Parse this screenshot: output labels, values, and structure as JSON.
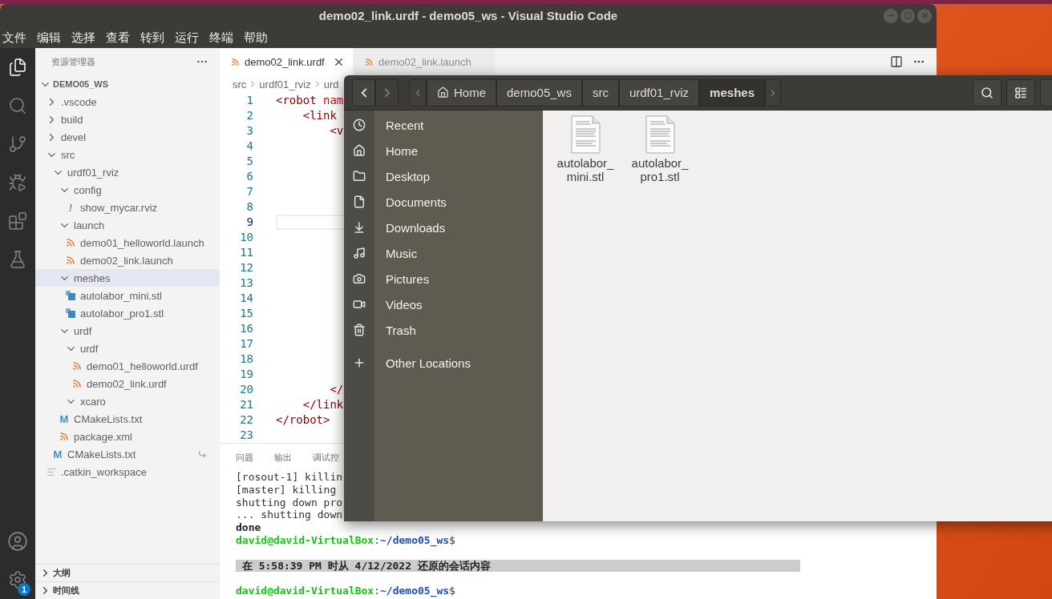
{
  "vscode": {
    "title": "demo02_link.urdf - demo05_ws - Visual Studio Code",
    "menu": [
      "文件",
      "编辑",
      "选择",
      "查看",
      "转到",
      "运行",
      "终端",
      "帮助"
    ],
    "activity_bar": {
      "top": [
        {
          "selected": true
        },
        {
          "selected": false
        },
        {
          "selected": false
        },
        {
          "selected": false
        },
        {
          "selected": false
        },
        {
          "selected": false
        }
      ],
      "bottom": [
        {
          "selected": false
        },
        {
          "selected": false
        }
      ],
      "badge": "1"
    },
    "explorer": {
      "title": "资源管理器",
      "root": {
        "label": "DEMO05_WS",
        "expanded": true
      },
      "tree": [
        {
          "label": ".vscode",
          "kind": "folder",
          "expanded": false,
          "selected": false
        },
        {
          "label": "build",
          "kind": "folder",
          "expanded": false,
          "selected": false
        },
        {
          "label": "devel",
          "kind": "folder",
          "expanded": false,
          "selected": false
        },
        {
          "label": "src",
          "kind": "folder",
          "expanded": true,
          "selected": false,
          "children": [
            {
              "label": "urdf01_rviz",
              "kind": "folder",
              "expanded": true,
              "selected": false,
              "children": [
                {
                  "label": "config",
                  "kind": "folder",
                  "expanded": true,
                  "selected": false,
                  "children": [
                    {
                      "label": "show_mycar.rviz",
                      "kind": "rviz",
                      "glyph": "!",
                      "selected": false
                    }
                  ]
                },
                {
                  "label": "launch",
                  "kind": "folder",
                  "expanded": true,
                  "selected": false,
                  "children": [
                    {
                      "label": "demo01_helloworld.launch",
                      "kind": "rss",
                      "selected": false
                    },
                    {
                      "label": "demo02_link.launch",
                      "kind": "rss",
                      "selected": false
                    }
                  ]
                },
                {
                  "label": "meshes",
                  "kind": "folder",
                  "expanded": true,
                  "selected": true,
                  "children": [
                    {
                      "label": "autolabor_mini.stl",
                      "kind": "stl",
                      "selected": false
                    },
                    {
                      "label": "autolabor_pro1.stl",
                      "kind": "stl",
                      "selected": false
                    }
                  ]
                },
                {
                  "label": "urdf",
                  "kind": "folder",
                  "expanded": true,
                  "selected": false,
                  "children": [
                    {
                      "label": "urdf",
                      "kind": "folder",
                      "expanded": true,
                      "selected": false,
                      "children": [
                        {
                          "label": "demo01_helloworld.urdf",
                          "kind": "rss",
                          "selected": false
                        },
                        {
                          "label": "demo02_link.urdf",
                          "kind": "rss",
                          "selected": false
                        }
                      ]
                    },
                    {
                      "label": "xcaro",
                      "kind": "folder",
                      "expanded": true,
                      "selected": false
                    }
                  ]
                },
                {
                  "label": "CMakeLists.txt",
                  "kind": "cmake",
                  "glyph": "M",
                  "selected": false
                },
                {
                  "label": "package.xml",
                  "kind": "rss",
                  "selected": false
                }
              ]
            },
            {
              "label": "CMakeLists.txt",
              "kind": "cmake",
              "glyph": "M",
              "selected": false,
              "symlink": true
            }
          ]
        },
        {
          "label": ".catkin_workspace",
          "kind": "text",
          "selected": false
        }
      ],
      "sections": [
        {
          "label": "大纲",
          "expanded": false
        },
        {
          "label": "时间线",
          "expanded": false
        }
      ]
    },
    "tabs": [
      {
        "label": "demo02_link.urdf",
        "selected": true
      },
      {
        "label": "demo02_link.launch",
        "selected": false
      }
    ],
    "breadcrumbs": [
      "src",
      "urdf01_rviz",
      "urd"
    ],
    "code_lines": [
      {
        "number": "1",
        "current": false,
        "tokens": [
          {
            "kind": "tag",
            "text": "<robot"
          },
          {
            "kind": "attr",
            "text": " nam"
          }
        ]
      },
      {
        "number": "2",
        "current": false,
        "tokens": [
          {
            "kind": "tag",
            "text": "    <link"
          }
        ]
      },
      {
        "number": "3",
        "current": false,
        "tokens": [
          {
            "kind": "tag",
            "text": "        <v"
          }
        ]
      },
      {
        "number": "4",
        "current": false
      },
      {
        "number": "5",
        "current": false
      },
      {
        "number": "6",
        "current": false
      },
      {
        "number": "7",
        "current": false
      },
      {
        "number": "8",
        "current": false
      },
      {
        "number": "9",
        "current": true
      },
      {
        "number": "10",
        "current": false
      },
      {
        "number": "11",
        "current": false
      },
      {
        "number": "12",
        "current": false
      },
      {
        "number": "13",
        "current": false
      },
      {
        "number": "14",
        "current": false
      },
      {
        "number": "15",
        "current": false
      },
      {
        "number": "16",
        "current": false
      },
      {
        "number": "17",
        "current": false
      },
      {
        "number": "18",
        "current": false
      },
      {
        "number": "19",
        "current": false
      },
      {
        "number": "20",
        "current": false,
        "tokens": [
          {
            "kind": "tag",
            "text": "        </"
          }
        ]
      },
      {
        "number": "21",
        "current": false,
        "tokens": [
          {
            "kind": "tag",
            "text": "    </link"
          }
        ]
      },
      {
        "number": "22",
        "current": false,
        "tokens": [
          {
            "kind": "tag",
            "text": "</robot>"
          }
        ]
      },
      {
        "number": "23",
        "current": false
      }
    ],
    "panel_tabs": [
      "问题",
      "输出",
      "调试控"
    ],
    "terminal": [
      {
        "kind": "plain",
        "parts": [
          {
            "kind": "plain",
            "text": "[rosout-1] killin"
          }
        ]
      },
      {
        "kind": "plain",
        "parts": [
          {
            "kind": "plain",
            "text": "[master] killing"
          }
        ]
      },
      {
        "kind": "plain",
        "parts": [
          {
            "kind": "plain",
            "text": "shutting down pro"
          }
        ]
      },
      {
        "kind": "plain",
        "parts": [
          {
            "kind": "plain",
            "text": "... shutting down"
          }
        ]
      },
      {
        "kind": "plain",
        "parts": [
          {
            "kind": "bold",
            "text": "done"
          }
        ]
      },
      {
        "kind": "plain",
        "parts": [
          {
            "kind": "user",
            "text": "david@david-VirtualBox"
          },
          {
            "kind": "plain",
            "text": ":"
          },
          {
            "kind": "path",
            "text": "~/demo05_ws"
          },
          {
            "kind": "plain",
            "text": "$"
          }
        ]
      },
      {
        "kind": "blank"
      },
      {
        "kind": "banner",
        "parts": [
          {
            "kind": "bold",
            "text": " 在 5:58:39 PM 时从 4/12/2022 还原的会话内容"
          }
        ]
      },
      {
        "kind": "blank"
      },
      {
        "kind": "plain",
        "parts": [
          {
            "kind": "user",
            "text": "david@david-VirtualBox"
          },
          {
            "kind": "plain",
            "text": ":"
          },
          {
            "kind": "path",
            "text": "~/demo05_ws"
          },
          {
            "kind": "plain",
            "text": "$"
          }
        ]
      }
    ]
  },
  "files": {
    "nav": [
      {
        "disabled": false
      },
      {
        "disabled": true
      }
    ],
    "path": [
      {
        "label": "Home",
        "kind": "home",
        "selected": false
      },
      {
        "label": "demo05_ws",
        "kind": "folder",
        "selected": false
      },
      {
        "label": "src",
        "kind": "folder",
        "selected": false
      },
      {
        "label": "urdf01_rviz",
        "kind": "folder",
        "selected": false
      },
      {
        "label": "meshes",
        "kind": "folder",
        "selected": true
      }
    ],
    "places": [
      {
        "label": "Recent",
        "selected": false
      },
      {
        "label": "Home",
        "selected": false
      },
      {
        "label": "Desktop",
        "selected": false
      },
      {
        "label": "Documents",
        "selected": false
      },
      {
        "label": "Downloads",
        "selected": false
      },
      {
        "label": "Music",
        "selected": false
      },
      {
        "label": "Pictures",
        "selected": false
      },
      {
        "label": "Videos",
        "selected": false
      },
      {
        "label": "Trash",
        "selected": false
      }
    ],
    "other_locations": {
      "label": "Other Locations",
      "selected": false
    },
    "items": [
      {
        "name_lines": [
          "autolabor_",
          "mini.stl"
        ],
        "selected": false
      },
      {
        "name_lines": [
          "autolabor_",
          "pro1.stl"
        ],
        "selected": false
      }
    ]
  }
}
